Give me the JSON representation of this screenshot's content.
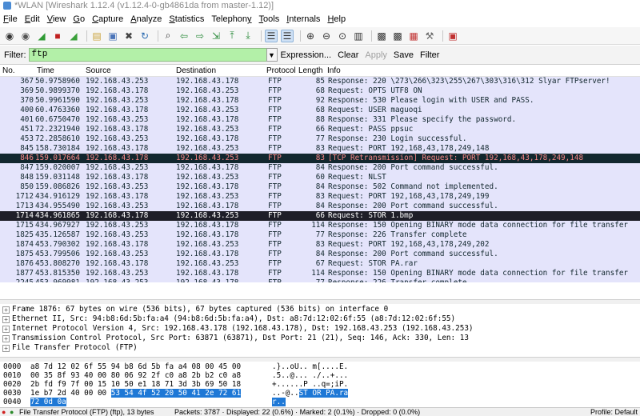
{
  "window": {
    "title": "*WLAN   [Wireshark 1.12.4  (v1.12.4-0-gb4861da from master-1.12)]"
  },
  "menu": [
    {
      "pre": "",
      "key": "F",
      "post": "ile"
    },
    {
      "pre": "",
      "key": "E",
      "post": "dit"
    },
    {
      "pre": "",
      "key": "V",
      "post": "iew"
    },
    {
      "pre": "",
      "key": "G",
      "post": "o"
    },
    {
      "pre": "",
      "key": "C",
      "post": "apture"
    },
    {
      "pre": "",
      "key": "A",
      "post": "nalyze"
    },
    {
      "pre": "",
      "key": "S",
      "post": "tatistics"
    },
    {
      "pre": "Telephon",
      "key": "y",
      "post": ""
    },
    {
      "pre": "",
      "key": "T",
      "post": "ools"
    },
    {
      "pre": "",
      "key": "I",
      "post": "nternals"
    },
    {
      "pre": "",
      "key": "H",
      "post": "elp"
    }
  ],
  "toolbar": {
    "icons": [
      "interfaces-icon",
      "options-icon",
      "start-capture-icon",
      "stop-capture-icon",
      "restart-capture-icon",
      "sep",
      "open-file-icon",
      "save-file-icon",
      "close-file-icon",
      "reload-icon",
      "sep",
      "find-icon",
      "go-back-icon",
      "go-forward-icon",
      "go-to-packet-icon",
      "go-first-icon",
      "go-last-icon",
      "sep",
      "colorize-icon",
      "autoscroll-icon",
      "sep",
      "zoom-in-icon",
      "zoom-out-icon",
      "zoom-normal-icon",
      "resize-columns-icon",
      "sep",
      "capture-filters-icon",
      "display-filters-icon",
      "coloring-rules-icon",
      "preferences-icon",
      "sep",
      "help-icon"
    ]
  },
  "filter": {
    "label": "Filter:",
    "value": "ftp",
    "links": [
      {
        "label": "Expression...",
        "disabled": false
      },
      {
        "label": "Clear",
        "disabled": false
      },
      {
        "label": "Apply",
        "disabled": true
      },
      {
        "label": "Save",
        "disabled": false
      },
      {
        "label": "Filter",
        "disabled": false
      }
    ]
  },
  "columns": {
    "no": "No.",
    "time": "Time",
    "source": "Source",
    "destination": "Destination",
    "protocol": "Protocol",
    "length": "Length",
    "info": "Info"
  },
  "packets": [
    {
      "no": "367",
      "time": "50.9758960",
      "src": "192.168.43.253",
      "dst": "192.168.43.178",
      "proto": "FTP",
      "len": "85",
      "info": "Response: 220 \\273\\266\\323\\255\\267\\303\\316\\312 Slyar FTPserver!",
      "style": "normal"
    },
    {
      "no": "369",
      "time": "50.9899370",
      "src": "192.168.43.178",
      "dst": "192.168.43.253",
      "proto": "FTP",
      "len": "68",
      "info": "Request: OPTS UTF8 ON",
      "style": "normal"
    },
    {
      "no": "370",
      "time": "50.9961590",
      "src": "192.168.43.253",
      "dst": "192.168.43.178",
      "proto": "FTP",
      "len": "92",
      "info": "Response: 530 Please login with USER and PASS.",
      "style": "normal"
    },
    {
      "no": "400",
      "time": "60.4763360",
      "src": "192.168.43.178",
      "dst": "192.168.43.253",
      "proto": "FTP",
      "len": "68",
      "info": "Request: USER maguoqi",
      "style": "normal"
    },
    {
      "no": "401",
      "time": "60.6750470",
      "src": "192.168.43.253",
      "dst": "192.168.43.178",
      "proto": "FTP",
      "len": "88",
      "info": "Response: 331 Please specify the password.",
      "style": "normal"
    },
    {
      "no": "451",
      "time": "72.2321940",
      "src": "192.168.43.178",
      "dst": "192.168.43.253",
      "proto": "FTP",
      "len": "66",
      "info": "Request: PASS ppsuc",
      "style": "normal"
    },
    {
      "no": "453",
      "time": "72.2858610",
      "src": "192.168.43.253",
      "dst": "192.168.43.178",
      "proto": "FTP",
      "len": "77",
      "info": "Response: 230 Login successful.",
      "style": "normal"
    },
    {
      "no": "845",
      "time": "158.730184",
      "src": "192.168.43.178",
      "dst": "192.168.43.253",
      "proto": "FTP",
      "len": "83",
      "info": "Request: PORT 192,168,43,178,249,148",
      "style": "normal"
    },
    {
      "no": "846",
      "time": "159.017664",
      "src": "192.168.43.178",
      "dst": "192.168.43.253",
      "proto": "FTP",
      "len": "83",
      "info": "[TCP Retransmission] Request: PORT 192,168,43,178,249,148",
      "style": "black"
    },
    {
      "no": "847",
      "time": "159.020007",
      "src": "192.168.43.253",
      "dst": "192.168.43.178",
      "proto": "FTP",
      "len": "84",
      "info": "Response: 200 Port command successful.",
      "style": "normal"
    },
    {
      "no": "848",
      "time": "159.031148",
      "src": "192.168.43.178",
      "dst": "192.168.43.253",
      "proto": "FTP",
      "len": "60",
      "info": "Request: NLST",
      "style": "normal"
    },
    {
      "no": "850",
      "time": "159.086826",
      "src": "192.168.43.253",
      "dst": "192.168.43.178",
      "proto": "FTP",
      "len": "84",
      "info": "Response: 502 Command not implemented.",
      "style": "normal"
    },
    {
      "no": "1712",
      "time": "434.916129",
      "src": "192.168.43.178",
      "dst": "192.168.43.253",
      "proto": "FTP",
      "len": "83",
      "info": "Request: PORT 192,168,43,178,249,199",
      "style": "normal"
    },
    {
      "no": "1713",
      "time": "434.955490",
      "src": "192.168.43.253",
      "dst": "192.168.43.178",
      "proto": "FTP",
      "len": "84",
      "info": "Response: 200 Port command successful.",
      "style": "normal"
    },
    {
      "no": "1714",
      "time": "434.961865",
      "src": "192.168.43.178",
      "dst": "192.168.43.253",
      "proto": "FTP",
      "len": "66",
      "info": "Request: STOR 1.bmp",
      "style": "selected"
    },
    {
      "no": "1715",
      "time": "434.967927",
      "src": "192.168.43.253",
      "dst": "192.168.43.178",
      "proto": "FTP",
      "len": "114",
      "info": "Response: 150 Opening BINARY mode data connection for file transfer",
      "style": "normal"
    },
    {
      "no": "1825",
      "time": "435.126587",
      "src": "192.168.43.253",
      "dst": "192.168.43.178",
      "proto": "FTP",
      "len": "77",
      "info": "Response: 226 Transfer complete",
      "style": "normal"
    },
    {
      "no": "1874",
      "time": "453.790302",
      "src": "192.168.43.178",
      "dst": "192.168.43.253",
      "proto": "FTP",
      "len": "83",
      "info": "Request: PORT 192,168,43,178,249,202",
      "style": "normal"
    },
    {
      "no": "1875",
      "time": "453.799506",
      "src": "192.168.43.253",
      "dst": "192.168.43.178",
      "proto": "FTP",
      "len": "84",
      "info": "Response: 200 Port command successful.",
      "style": "normal"
    },
    {
      "no": "1876",
      "time": "453.808270",
      "src": "192.168.43.178",
      "dst": "192.168.43.253",
      "proto": "FTP",
      "len": "67",
      "info": "Request: STOR PA.rar",
      "style": "normal"
    },
    {
      "no": "1877",
      "time": "453.815350",
      "src": "192.168.43.253",
      "dst": "192.168.43.178",
      "proto": "FTP",
      "len": "114",
      "info": "Response: 150 Opening BINARY mode data connection for file transfer",
      "style": "normal"
    },
    {
      "no": "2245",
      "time": "453.969981",
      "src": "192.168.43.253",
      "dst": "192.168.43.178",
      "proto": "FTP",
      "len": "77",
      "info": "Response: 226 Transfer complete",
      "style": "normal"
    }
  ],
  "details": [
    "Frame 1876: 67 bytes on wire (536 bits), 67 bytes captured (536 bits) on interface 0",
    "Ethernet II, Src: 94:b8:6d:5b:fa:a4 (94:b8:6d:5b:fa:a4), Dst: a8:7d:12:02:6f:55 (a8:7d:12:02:6f:55)",
    "Internet Protocol Version 4, Src: 192.168.43.178 (192.168.43.178), Dst: 192.168.43.253 (192.168.43.253)",
    "Transmission Control Protocol, Src Port: 63871 (63871), Dst Port: 21 (21), Seq: 146, Ack: 330, Len: 13",
    "File Transfer Protocol (FTP)"
  ],
  "bytes": [
    {
      "off": "0000",
      "hex": "a8 7d 12 02 6f 55 94 b8  6d 5b fa a4 08 00 45 00",
      "hexhl": "",
      "ascii": ".}..oU.. m[....E.",
      "asciihl": ""
    },
    {
      "off": "0010",
      "hex": "00 35 8f 93 40 00 80 06  92 2f c0 a8 2b b2 c0 a8",
      "hexhl": "",
      "ascii": ".5..@... ./..+...",
      "asciihl": ""
    },
    {
      "off": "0020",
      "hex": "2b fd f9 7f 00 15 10 50  e1 18 71 3d 3b 69 50 18",
      "hexhl": "",
      "ascii": "+......P ..q=;iP.",
      "asciihl": ""
    },
    {
      "off": "0030",
      "hex": "1e b7 2d 40 00 00 ",
      "hexhl": "53 54  4f 52 20 50 41 2e 72 61",
      "ascii": "..-@..",
      "asciihl": "ST OR PA.ra"
    },
    {
      "off": "0040",
      "hex": "",
      "hexhl": "72 0d 0a",
      "ascii": "",
      "asciihl": "r.."
    }
  ],
  "status": {
    "file": "File Transfer Protocol (FTP) (ftp), 13 bytes",
    "packets": "Packets: 3787 · Displayed: 22 (0.6%) · Marked: 2 (0.1%) · Dropped: 0 (0.0%)",
    "profile": "Profile: Default"
  },
  "colors": {
    "ftp_row_bg": "#e4e4fb",
    "bad_row_bg": "#12272e",
    "bad_row_fg": "#f78787",
    "filter_ok_bg": "#b3f0a8",
    "selection_bg": "#1e78d6"
  }
}
